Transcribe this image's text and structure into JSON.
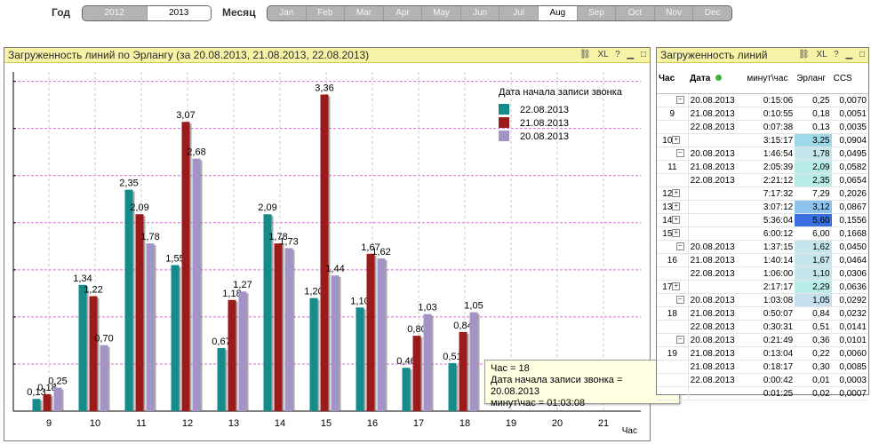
{
  "filters": {
    "year_label": "Год",
    "years": [
      "2012",
      "2013"
    ],
    "selected_year": "2013",
    "month_label": "Месяц",
    "months": [
      "Jan",
      "Feb",
      "Mar",
      "Apr",
      "May",
      "Jun",
      "Jul",
      "Aug",
      "Sep",
      "Oct",
      "Nov",
      "Dec"
    ],
    "selected_month": "Aug"
  },
  "chart_panel": {
    "title": "Загруженность линий по Эрлангу (за 20.08.2013, 21.08.2013, 22.08.2013)",
    "icon_xl": "XL",
    "icon_help": "?",
    "icon_min": "▁",
    "icon_max": "□"
  },
  "chart_data": {
    "type": "bar",
    "categories": [
      "9",
      "10",
      "11",
      "12",
      "13",
      "14",
      "15",
      "16",
      "17",
      "18",
      "19",
      "20",
      "21"
    ],
    "xlabel": "Час",
    "legend_title": "Дата начала записи звонка",
    "legend_position": "top-right",
    "grid": true,
    "ylim": [
      0,
      3.6
    ],
    "series": [
      {
        "name": "22.08.2013",
        "color": "#148c8c",
        "values": [
          0.13,
          1.34,
          2.35,
          1.55,
          0.67,
          2.09,
          1.2,
          1.1,
          0.46,
          0.51,
          null,
          null,
          null
        ]
      },
      {
        "name": "21.08.2013",
        "color": "#9b1b1b",
        "values": [
          0.18,
          1.22,
          2.09,
          3.07,
          1.18,
          1.78,
          3.36,
          1.67,
          0.8,
          0.84,
          null,
          null,
          null
        ]
      },
      {
        "name": "20.08.2013",
        "color": "#a493c6",
        "values": [
          0.25,
          0.7,
          1.78,
          2.68,
          1.27,
          1.73,
          1.44,
          1.62,
          1.03,
          1.05,
          null,
          null,
          null
        ]
      }
    ]
  },
  "tooltip": {
    "line1": "Час = 18",
    "line2": "Дата начала записи звонка = 20.08.2013",
    "line3": "минут\\час = 01:03:08"
  },
  "table_panel": {
    "title": "Загруженность линий",
    "icon_xl": "XL",
    "icon_help": "?",
    "icon_min": "▁",
    "icon_max": "□",
    "headers": [
      "Час",
      "Дата",
      "минут\\час",
      "Эрланг",
      "CCS"
    ],
    "rows": [
      {
        "hour": "",
        "date": "20.08.2013",
        "min": "0:15:06",
        "erl": "0,25",
        "ccs": "0,0070",
        "shade": "",
        "pm": "-"
      },
      {
        "hour": "9",
        "date": "21.08.2013",
        "min": "0:10:55",
        "erl": "0,18",
        "ccs": "0,0051",
        "shade": "",
        "pm": ""
      },
      {
        "hour": "",
        "date": "22.08.2013",
        "min": "0:07:38",
        "erl": "0,13",
        "ccs": "0,0035",
        "shade": "",
        "pm": ""
      },
      {
        "hour": "10",
        "date": "",
        "min": "3:15:17",
        "erl": "3,25",
        "ccs": "0,0904",
        "shade": "#9fd8e8",
        "pm": "+"
      },
      {
        "hour": "",
        "date": "20.08.2013",
        "min": "1:46:54",
        "erl": "1,78",
        "ccs": "0,0495",
        "shade": "#c6e6ee",
        "pm": "-"
      },
      {
        "hour": "11",
        "date": "21.08.2013",
        "min": "2:05:39",
        "erl": "2,09",
        "ccs": "0,0582",
        "shade": "#b9ece8",
        "pm": ""
      },
      {
        "hour": "",
        "date": "22.08.2013",
        "min": "2:21:12",
        "erl": "2,35",
        "ccs": "0,0654",
        "shade": "#b9ece8",
        "pm": ""
      },
      {
        "hour": "12",
        "date": "",
        "min": "7:17:32",
        "erl": "7,29",
        "ccs": "0,2026",
        "shade": "",
        "pm": "+"
      },
      {
        "hour": "13",
        "date": "",
        "min": "3:07:12",
        "erl": "3,12",
        "ccs": "0,0867",
        "shade": "#8ec3ee",
        "pm": "+"
      },
      {
        "hour": "14",
        "date": "",
        "min": "5:36:04",
        "erl": "5,60",
        "ccs": "0,1556",
        "shade": "#3a6fe0",
        "pm": "+"
      },
      {
        "hour": "15",
        "date": "",
        "min": "6:00:12",
        "erl": "6,00",
        "ccs": "0,1668",
        "shade": "",
        "pm": "+"
      },
      {
        "hour": "",
        "date": "20.08.2013",
        "min": "1:37:15",
        "erl": "1,62",
        "ccs": "0,0450",
        "shade": "#c6e6ee",
        "pm": "-"
      },
      {
        "hour": "16",
        "date": "21.08.2013",
        "min": "1:40:14",
        "erl": "1,67",
        "ccs": "0,0464",
        "shade": "#c6e6ee",
        "pm": ""
      },
      {
        "hour": "",
        "date": "22.08.2013",
        "min": "1:06:00",
        "erl": "1,10",
        "ccs": "0,0306",
        "shade": "#c6e6ee",
        "pm": ""
      },
      {
        "hour": "17",
        "date": "",
        "min": "2:17:17",
        "erl": "2,29",
        "ccs": "0,0636",
        "shade": "#b9ece8",
        "pm": "+"
      },
      {
        "hour": "",
        "date": "20.08.2013",
        "min": "1:03:08",
        "erl": "1,05",
        "ccs": "0,0292",
        "shade": "#c6e0ee",
        "pm": "-"
      },
      {
        "hour": "18",
        "date": "21.08.2013",
        "min": "0:50:07",
        "erl": "0,84",
        "ccs": "0,0232",
        "shade": "",
        "pm": ""
      },
      {
        "hour": "",
        "date": "22.08.2013",
        "min": "0:30:31",
        "erl": "0,51",
        "ccs": "0,0141",
        "shade": "",
        "pm": ""
      },
      {
        "hour": "",
        "date": "20.08.2013",
        "min": "0:21:49",
        "erl": "0,36",
        "ccs": "0,0101",
        "shade": "",
        "pm": "-"
      },
      {
        "hour": "19",
        "date": "21.08.2013",
        "min": "0:13:04",
        "erl": "0,22",
        "ccs": "0,0060",
        "shade": "",
        "pm": ""
      },
      {
        "hour": "",
        "date": "21.08.2013",
        "min": "0:18:17",
        "erl": "0,30",
        "ccs": "0,0085",
        "shade": "",
        "pm": ""
      },
      {
        "hour": "",
        "date": "22.08.2013",
        "min": "0:00:42",
        "erl": "0,01",
        "ccs": "0,0003",
        "shade": "",
        "pm": ""
      },
      {
        "hour": "",
        "date": "",
        "min": "0:01:25",
        "erl": "0,02",
        "ccs": "0,0007",
        "shade": "",
        "pm": ""
      }
    ]
  }
}
